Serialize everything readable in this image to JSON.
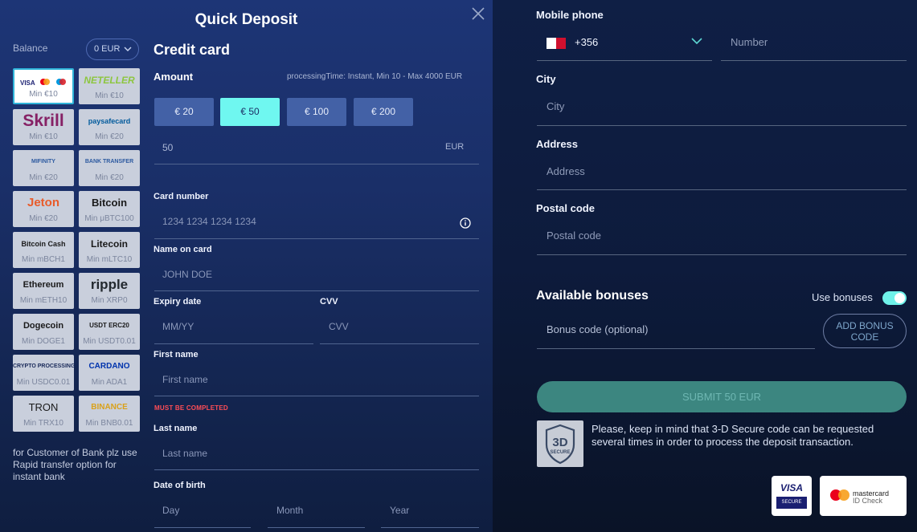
{
  "title": "Quick Deposit",
  "balance": {
    "label": "Balance",
    "value": "0 EUR"
  },
  "payment_methods": [
    {
      "id": "cards",
      "label": "",
      "min": "Min €10",
      "selected": true
    },
    {
      "id": "neteller",
      "label": "NETELLER",
      "min": "Min €10"
    },
    {
      "id": "skrill",
      "label": "Skrill",
      "min": "Min €10"
    },
    {
      "id": "paysafecard",
      "label": "paysafecard",
      "min": "Min €20"
    },
    {
      "id": "mifinity",
      "label": "MIFINITY",
      "min": "Min €20"
    },
    {
      "id": "bank",
      "label": "BANK TRANSFER",
      "min": "Min €20"
    },
    {
      "id": "jeton",
      "label": "Jeton",
      "min": "Min €20"
    },
    {
      "id": "bitcoin",
      "label": "Bitcoin",
      "min": "Min μBTC100"
    },
    {
      "id": "bitcoincash",
      "label": "Bitcoin Cash",
      "min": "Min mBCH1"
    },
    {
      "id": "litecoin",
      "label": "Litecoin",
      "min": "Min mLTC10"
    },
    {
      "id": "ethereum",
      "label": "Ethereum",
      "min": "Min mETH10"
    },
    {
      "id": "ripple",
      "label": "ripple",
      "min": "Min XRP0"
    },
    {
      "id": "dogecoin",
      "label": "Dogecoin",
      "min": "Min DOGE1"
    },
    {
      "id": "usdt",
      "label": "USDT ERC20",
      "min": "Min USDT0.01"
    },
    {
      "id": "cryptoprocessing",
      "label": "CRYPTO PROCESSING",
      "min": "Min USDC0.01"
    },
    {
      "id": "cardano",
      "label": "CARDANO",
      "min": "Min ADA1"
    },
    {
      "id": "tron",
      "label": "TRON",
      "min": "Min TRX10"
    },
    {
      "id": "binance",
      "label": "BINANCE",
      "min": "Min BNB0.01"
    }
  ],
  "sidebar_note": "for Customer of Bank plz use Rapid transfer option for instant bank",
  "form": {
    "section_title": "Credit card",
    "amount_label": "Amount",
    "processing_time": "processingTime: Instant, Min 10 - Max 4000 EUR",
    "amount_buttons": [
      "€ 20",
      "€ 50",
      "€ 100",
      "€ 200"
    ],
    "amount_value": "50",
    "currency": "EUR",
    "card_number_label": "Card number",
    "card_number_placeholder": "1234 1234 1234 1234",
    "name_label": "Name on card",
    "name_placeholder": "JOHN DOE",
    "expiry_label": "Expiry date",
    "expiry_placeholder": "MM/YY",
    "cvv_label": "CVV",
    "cvv_placeholder": "CVV",
    "first_name_label": "First name",
    "first_name_placeholder": "First name",
    "error_text": "MUST BE COMPLETED",
    "last_name_label": "Last name",
    "last_name_placeholder": "Last name",
    "dob_label": "Date of birth",
    "dob_day": "Day",
    "dob_month": "Month",
    "dob_year": "Year"
  },
  "right": {
    "mobile_label": "Mobile phone",
    "country_code": "+356",
    "number_placeholder": "Number",
    "city_label": "City",
    "city_placeholder": "City",
    "address_label": "Address",
    "address_placeholder": "Address",
    "postal_label": "Postal code",
    "postal_placeholder": "Postal code",
    "bonuses_title": "Available bonuses",
    "use_bonuses_label": "Use bonuses",
    "use_bonuses_on": true,
    "bonus_code_placeholder": "Bonus code (optional)",
    "add_bonus_label": "ADD BONUS CODE",
    "submit_label": "SUBMIT 50 EUR",
    "secure_note": "Please, keep in mind that 3-D Secure code can be requested several times in order to process the deposit transaction.",
    "secure_badge_text": "3D",
    "secure_badge_sub": "SECURE",
    "visa_badge_text": "VISA",
    "visa_badge_sub": "SECURE",
    "mc_badge_text": "mastercard",
    "mc_badge_sub": "ID Check"
  },
  "colors": {
    "accent_cyan": "#6ff7f0",
    "error_red": "#ff4d56",
    "submit_teal": "#3c8680"
  }
}
